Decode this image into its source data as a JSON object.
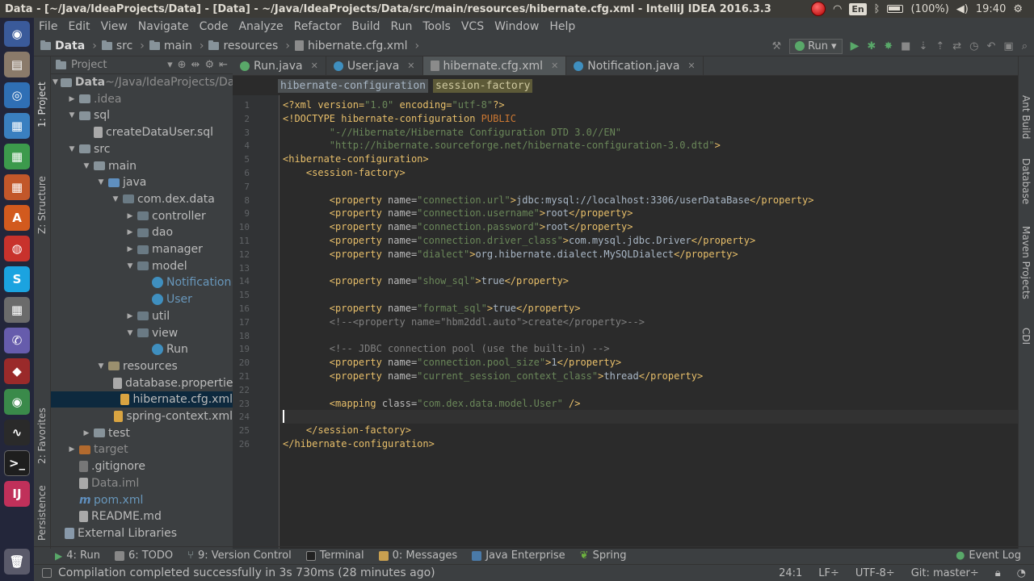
{
  "window": {
    "title": "Data - [~/Java/IdeaProjects/Data] - [Data] - ~/Java/IdeaProjects/Data/src/main/resources/hibernate.cfg.xml - IntelliJ IDEA 2016.3.3"
  },
  "tray": {
    "lang": "En",
    "battery": "(100%)",
    "time": "19:40"
  },
  "menu": [
    "File",
    "Edit",
    "View",
    "Navigate",
    "Code",
    "Analyze",
    "Refactor",
    "Build",
    "Run",
    "Tools",
    "VCS",
    "Window",
    "Help"
  ],
  "breadcrumb": [
    "Data",
    "src",
    "main",
    "resources",
    "hibernate.cfg.xml"
  ],
  "run_config": "Run",
  "left_stripe": [
    "1: Project",
    "Z: Structure",
    "2: Favorites",
    "Persistence"
  ],
  "right_stripe": [
    "Ant Build",
    "Database",
    "Maven Projects",
    "CDI"
  ],
  "project": {
    "header": "Project",
    "tree": [
      {
        "label": "Data",
        "suffix": " ~/Java/IdeaProjects/Data",
        "arrow": "▼",
        "icon": "f-folder",
        "indent": 0,
        "bold": true
      },
      {
        "label": ".idea",
        "arrow": "▶",
        "icon": "f-folder",
        "indent": 1,
        "dim": true
      },
      {
        "label": "sql",
        "arrow": "▼",
        "icon": "f-folder",
        "indent": 1
      },
      {
        "label": "createDataUser.sql",
        "arrow": "",
        "icon": "f-file",
        "indent": 2
      },
      {
        "label": "src",
        "arrow": "▼",
        "icon": "f-folder",
        "indent": 1
      },
      {
        "label": "main",
        "arrow": "▼",
        "icon": "f-folder",
        "indent": 2
      },
      {
        "label": "java",
        "arrow": "▼",
        "icon": "f-src",
        "indent": 3
      },
      {
        "label": "com.dex.data",
        "arrow": "▼",
        "icon": "f-pkg",
        "indent": 4
      },
      {
        "label": "controller",
        "arrow": "▶",
        "icon": "f-pkg",
        "indent": 5
      },
      {
        "label": "dao",
        "arrow": "▶",
        "icon": "f-pkg",
        "indent": 5
      },
      {
        "label": "manager",
        "arrow": "▶",
        "icon": "f-pkg",
        "indent": 5
      },
      {
        "label": "model",
        "arrow": "▼",
        "icon": "f-pkg",
        "indent": 5
      },
      {
        "label": "Notification",
        "arrow": "",
        "icon": "f-class",
        "indent": 6,
        "blue": true
      },
      {
        "label": "User",
        "arrow": "",
        "icon": "f-class",
        "indent": 6,
        "blue": true
      },
      {
        "label": "util",
        "arrow": "▶",
        "icon": "f-pkg",
        "indent": 5
      },
      {
        "label": "view",
        "arrow": "▼",
        "icon": "f-pkg",
        "indent": 5
      },
      {
        "label": "Run",
        "arrow": "",
        "icon": "f-class",
        "indent": 6
      },
      {
        "label": "resources",
        "arrow": "▼",
        "icon": "f-res",
        "indent": 3
      },
      {
        "label": "database.properties",
        "arrow": "",
        "icon": "f-file",
        "indent": 4
      },
      {
        "label": "hibernate.cfg.xml",
        "arrow": "",
        "icon": "f-xml",
        "indent": 4,
        "selected": true
      },
      {
        "label": "spring-context.xml",
        "arrow": "",
        "icon": "f-xml",
        "indent": 4
      },
      {
        "label": "test",
        "arrow": "▶",
        "icon": "f-folder",
        "indent": 2
      },
      {
        "label": "target",
        "arrow": "▶",
        "icon": "f-target",
        "indent": 1,
        "dim": true
      },
      {
        "label": ".gitignore",
        "arrow": "",
        "icon": "f-git",
        "indent": 1
      },
      {
        "label": "Data.iml",
        "arrow": "",
        "icon": "f-file",
        "indent": 1,
        "dim": true
      },
      {
        "label": "pom.xml",
        "arrow": "",
        "icon": "f-maven",
        "indent": 1,
        "blue": true
      },
      {
        "label": "README.md",
        "arrow": "",
        "icon": "f-file",
        "indent": 1
      },
      {
        "label": "External Libraries",
        "arrow": "",
        "icon": "f-lib",
        "indent": 0
      }
    ]
  },
  "tabs": [
    {
      "label": "Run.java",
      "icon": "ricon",
      "active": false
    },
    {
      "label": "User.java",
      "icon": "cicon",
      "active": false
    },
    {
      "label": "hibernate.cfg.xml",
      "icon": "xml",
      "active": true
    },
    {
      "label": "Notification.java",
      "icon": "cicon",
      "active": false
    }
  ],
  "xml_breadcrumb": [
    "hibernate-configuration",
    "session-factory"
  ],
  "code": [
    [
      [
        "<?xml version=",
        "t"
      ],
      [
        "\"1.0\"",
        "v"
      ],
      [
        " encoding=",
        "t"
      ],
      [
        "\"utf-8\"",
        "v"
      ],
      [
        "?>",
        "t"
      ]
    ],
    [
      [
        "<!DOCTYPE hibernate-configuration ",
        "t"
      ],
      [
        "PUBLIC",
        "k"
      ]
    ],
    [
      [
        "        \"-//Hibernate/Hibernate Configuration DTD 3.0//EN\"",
        "v"
      ]
    ],
    [
      [
        "        \"http://hibernate.sourceforge.net/hibernate-configuration-3.0.dtd\"",
        "v"
      ],
      [
        ">",
        "t"
      ]
    ],
    [
      [
        "<hibernate-configuration>",
        "t"
      ]
    ],
    [
      [
        "    <session-factory>",
        "t"
      ]
    ],
    [],
    [
      [
        "        <property ",
        "t"
      ],
      [
        "name=",
        "a"
      ],
      [
        "\"connection.url\"",
        "v"
      ],
      [
        ">",
        "t"
      ],
      [
        "jdbc:mysql://localhost:3306/userDataBase",
        "tx"
      ],
      [
        "</property>",
        "t"
      ]
    ],
    [
      [
        "        <property ",
        "t"
      ],
      [
        "name=",
        "a"
      ],
      [
        "\"connection.username\"",
        "v"
      ],
      [
        ">",
        "t"
      ],
      [
        "root",
        "tx"
      ],
      [
        "</property>",
        "t"
      ]
    ],
    [
      [
        "        <property ",
        "t"
      ],
      [
        "name=",
        "a"
      ],
      [
        "\"connection.password\"",
        "v"
      ],
      [
        ">",
        "t"
      ],
      [
        "root",
        "tx"
      ],
      [
        "</property>",
        "t"
      ]
    ],
    [
      [
        "        <property ",
        "t"
      ],
      [
        "name=",
        "a"
      ],
      [
        "\"connection.driver_class\"",
        "v"
      ],
      [
        ">",
        "t"
      ],
      [
        "com.mysql.jdbc.Driver",
        "tx"
      ],
      [
        "</property>",
        "t"
      ]
    ],
    [
      [
        "        <property ",
        "t"
      ],
      [
        "name=",
        "a"
      ],
      [
        "\"dialect\"",
        "v"
      ],
      [
        ">",
        "t"
      ],
      [
        "org.hibernate.dialect.MySQLDialect",
        "tx"
      ],
      [
        "</property>",
        "t"
      ]
    ],
    [],
    [
      [
        "        <property ",
        "t"
      ],
      [
        "name=",
        "a"
      ],
      [
        "\"show_sql\"",
        "v"
      ],
      [
        ">",
        "t"
      ],
      [
        "true",
        "tx"
      ],
      [
        "</property>",
        "t"
      ]
    ],
    [],
    [
      [
        "        <property ",
        "t"
      ],
      [
        "name=",
        "a"
      ],
      [
        "\"format_sql\"",
        "v"
      ],
      [
        ">",
        "t"
      ],
      [
        "true",
        "tx"
      ],
      [
        "</property>",
        "t"
      ]
    ],
    [
      [
        "        <!--<property name=\"hbm2ddl.auto\">create</property>-->",
        "c"
      ]
    ],
    [],
    [
      [
        "        <!-- JDBC connection pool (use the built-in) -->",
        "c"
      ]
    ],
    [
      [
        "        <property ",
        "t"
      ],
      [
        "name=",
        "a"
      ],
      [
        "\"connection.pool_size\"",
        "v"
      ],
      [
        ">",
        "t"
      ],
      [
        "1",
        "tx"
      ],
      [
        "</property>",
        "t"
      ]
    ],
    [
      [
        "        <property ",
        "t"
      ],
      [
        "name=",
        "a"
      ],
      [
        "\"current_session_context_class\"",
        "v"
      ],
      [
        ">",
        "t"
      ],
      [
        "thread",
        "tx"
      ],
      [
        "</property>",
        "t"
      ]
    ],
    [],
    [
      [
        "        <mapping ",
        "t"
      ],
      [
        "class=",
        "a"
      ],
      [
        "\"com.dex.data.model.User\"",
        "v"
      ],
      [
        " />",
        "t"
      ]
    ],
    [],
    [
      [
        "    </session-factory>",
        "t"
      ]
    ],
    [
      [
        "</hibernate-configuration>",
        "t"
      ]
    ]
  ],
  "bottom_tabs": [
    "4: Run",
    "6: TODO",
    "9: Version Control",
    "Terminal",
    "0: Messages",
    "Java Enterprise",
    "Spring"
  ],
  "event_log": "Event Log",
  "status": {
    "message": "Compilation completed successfully in 3s 730ms (28 minutes ago)",
    "position": "24:1",
    "line_sep": "LF÷",
    "encoding": "UTF-8÷",
    "git": "Git: master÷"
  },
  "colors": {
    "accent": "#0d293e",
    "background": "#2b2b2b",
    "tag": "#e8bf6a",
    "string": "#6a8759"
  }
}
